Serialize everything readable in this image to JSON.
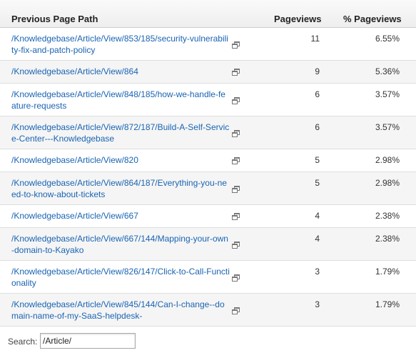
{
  "table": {
    "headers": {
      "path": "Previous Page Path",
      "pageviews": "Pageviews",
      "percent": "% Pageviews"
    },
    "rows": [
      {
        "path": "/Knowledgebase/Article/View/853/185/security-vulnerability-fix-and-patch-policy",
        "pageviews": "11",
        "percent": "6.55%"
      },
      {
        "path": "/Knowledgebase/Article/View/864",
        "pageviews": "9",
        "percent": "5.36%"
      },
      {
        "path": "/Knowledgebase/Article/View/848/185/how-we-handle-feature-requests",
        "pageviews": "6",
        "percent": "3.57%"
      },
      {
        "path": "/Knowledgebase/Article/View/872/187/Build-A-Self-Service-Center---Knowledgebase",
        "pageviews": "6",
        "percent": "3.57%"
      },
      {
        "path": "/Knowledgebase/Article/View/820",
        "pageviews": "5",
        "percent": "2.98%"
      },
      {
        "path": "/Knowledgebase/Article/View/864/187/Everything-you-need-to-know-about-tickets",
        "pageviews": "5",
        "percent": "2.98%"
      },
      {
        "path": "/Knowledgebase/Article/View/667",
        "pageviews": "4",
        "percent": "2.38%"
      },
      {
        "path": "/Knowledgebase/Article/View/667/144/Mapping-your-own-domain-to-Kayako",
        "pageviews": "4",
        "percent": "2.38%"
      },
      {
        "path": "/Knowledgebase/Article/View/826/147/Click-to-Call-Functionality",
        "pageviews": "3",
        "percent": "1.79%"
      },
      {
        "path": "/Knowledgebase/Article/View/845/144/Can-I-change--domain-name-of-my-SaaS-helpdesk-",
        "pageviews": "3",
        "percent": "1.79%"
      }
    ],
    "row_icon": "open-in-new-window-icon"
  },
  "search": {
    "label": "Search:",
    "value": "/Article/"
  },
  "colors": {
    "link": "#1a64b3",
    "row_alt": "#f5f5f5",
    "border": "#dedede"
  }
}
